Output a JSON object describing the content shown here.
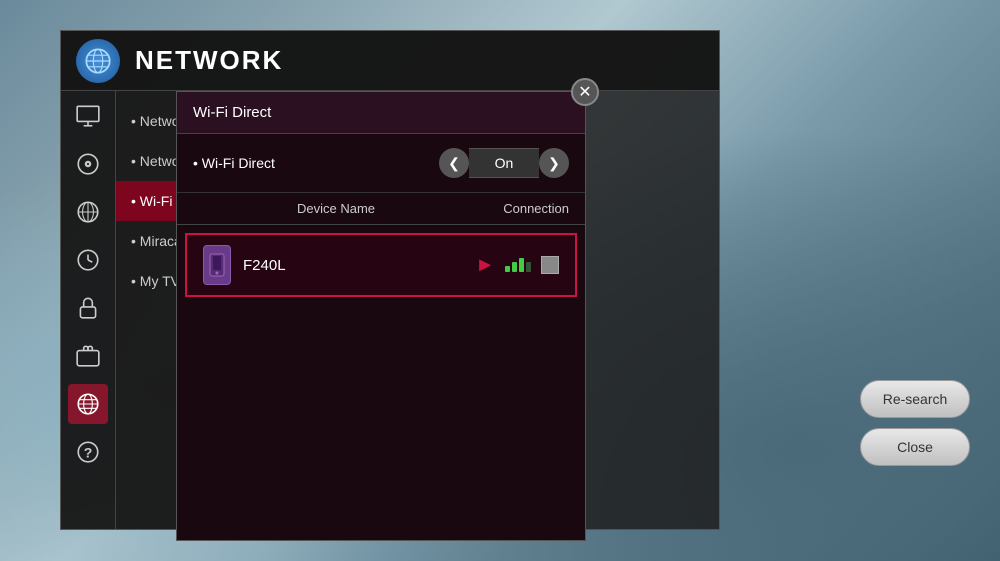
{
  "header": {
    "title": "NETWORK",
    "icon_label": "globe-icon"
  },
  "sidebar": {
    "icons": [
      {
        "name": "monitor-icon",
        "active": false,
        "symbol": "🖥"
      },
      {
        "name": "music-icon",
        "active": false,
        "symbol": "🎵"
      },
      {
        "name": "satellite-icon",
        "active": false,
        "symbol": "📡"
      },
      {
        "name": "clock-icon",
        "active": false,
        "symbol": "🕐"
      },
      {
        "name": "lock-icon",
        "active": false,
        "symbol": "🔒"
      },
      {
        "name": "briefcase-icon",
        "active": false,
        "symbol": "💼"
      },
      {
        "name": "network-icon",
        "active": true,
        "symbol": "🌐"
      },
      {
        "name": "help-icon",
        "active": false,
        "symbol": "❓"
      }
    ]
  },
  "nav_menu": {
    "items": [
      {
        "label": "Network Conn",
        "active": false
      },
      {
        "label": "Network Statu",
        "active": false
      },
      {
        "label": "Wi-Fi Direct",
        "active": true
      },
      {
        "label": "Miracast™ /In",
        "active": false
      },
      {
        "label": "My TV Name",
        "active": false
      }
    ]
  },
  "modal": {
    "title": "Wi-Fi Direct",
    "close_label": "✕",
    "wifi_direct_label": "Wi-Fi Direct",
    "toggle_left_arrow": "❮",
    "toggle_value": "On",
    "toggle_right_arrow": "❯",
    "table_headers": {
      "device_name": "Device Name",
      "connection": "Connection"
    },
    "devices": [
      {
        "name": "F240L",
        "icon": "phone-icon",
        "has_cursor": true,
        "signal_strength": 3,
        "has_indicator": true
      }
    ]
  },
  "actions": {
    "research_label": "Re-search",
    "close_label": "Close"
  }
}
